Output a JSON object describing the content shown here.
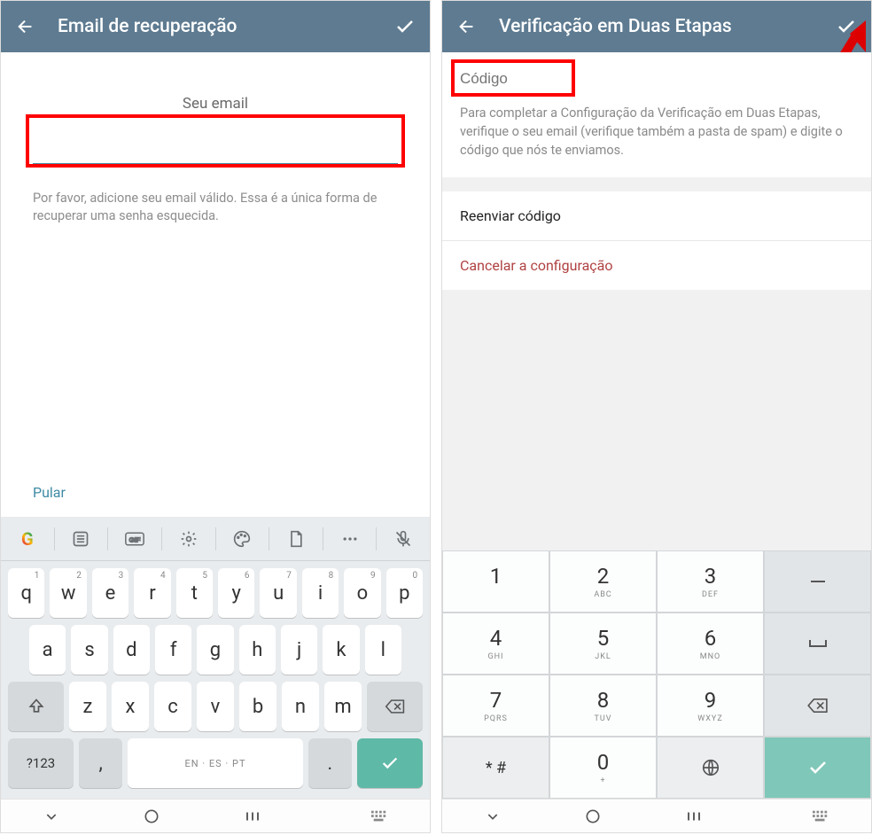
{
  "left": {
    "header": {
      "title": "Email de recuperação"
    },
    "email_label": "Seu email",
    "helper": "Por favor, adicione seu email válido. Essa é a única forma de recuperar uma senha esquecida.",
    "skip": "Pular"
  },
  "right": {
    "header": {
      "title": "Verificação em Duas Etapas"
    },
    "code_placeholder": "Código",
    "info": "Para completar a Configuração da Verificação em Duas Etapas, verifique o seu email (verifique também a pasta de spam) e digite o código que nós te enviamos.",
    "resend": "Reenviar código",
    "cancel": "Cancelar a configuração"
  },
  "qwerty": {
    "row1": [
      {
        "k": "q",
        "s": "1"
      },
      {
        "k": "w",
        "s": "2"
      },
      {
        "k": "e",
        "s": "3"
      },
      {
        "k": "r",
        "s": "4"
      },
      {
        "k": "t",
        "s": "5"
      },
      {
        "k": "y",
        "s": "6"
      },
      {
        "k": "u",
        "s": "7"
      },
      {
        "k": "i",
        "s": "8"
      },
      {
        "k": "o",
        "s": "9"
      },
      {
        "k": "p",
        "s": "0"
      }
    ],
    "row2": [
      {
        "k": "a",
        "s": ""
      },
      {
        "k": "s",
        "s": ""
      },
      {
        "k": "d",
        "s": ""
      },
      {
        "k": "f",
        "s": ""
      },
      {
        "k": "g",
        "s": ""
      },
      {
        "k": "h",
        "s": ""
      },
      {
        "k": "j",
        "s": ""
      },
      {
        "k": "k",
        "s": ""
      },
      {
        "k": "l",
        "s": ""
      }
    ],
    "row3": [
      {
        "k": "z",
        "s": ""
      },
      {
        "k": "x",
        "s": ""
      },
      {
        "k": "c",
        "s": ""
      },
      {
        "k": "v",
        "s": ""
      },
      {
        "k": "b",
        "s": ""
      },
      {
        "k": "n",
        "s": ""
      },
      {
        "k": "m",
        "s": ""
      }
    ],
    "bottom": {
      "numswitch": "?123",
      "comma": ",",
      "lang": "EN · ES · PT",
      "dot": "."
    }
  },
  "numpad": {
    "rows": [
      [
        {
          "n": "1",
          "s": ""
        },
        {
          "n": "2",
          "s": "ABC"
        },
        {
          "n": "3",
          "s": "DEF"
        }
      ],
      [
        {
          "n": "4",
          "s": "GHI"
        },
        {
          "n": "5",
          "s": "JKL"
        },
        {
          "n": "6",
          "s": "MNO"
        }
      ],
      [
        {
          "n": "7",
          "s": "PQRS"
        },
        {
          "n": "8",
          "s": "TUV"
        },
        {
          "n": "9",
          "s": "WXYZ"
        }
      ],
      [
        {
          "n": "* #",
          "s": ""
        },
        {
          "n": "0",
          "s": "+"
        },
        {
          "n": "",
          "s": ""
        }
      ]
    ],
    "side": [
      {
        "t": "—"
      },
      {
        "t": "␣"
      },
      {
        "t": "⌫"
      },
      {
        "t": "✓"
      }
    ]
  }
}
